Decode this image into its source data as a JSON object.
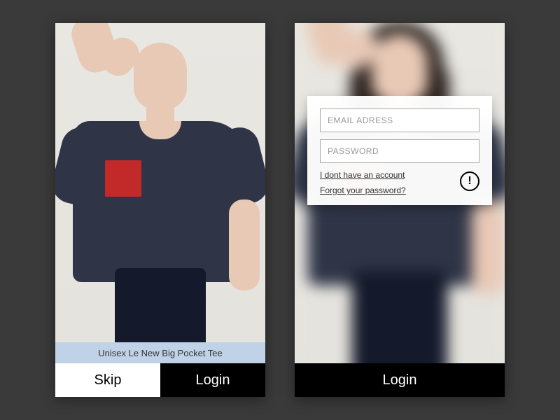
{
  "left": {
    "product_caption": "Unisex Le New Big Pocket Tee",
    "skip_label": "Skip",
    "login_label": "Login"
  },
  "right": {
    "email_placeholder": "EMAIL ADRESS",
    "password_placeholder": "PASSWORD",
    "no_account_link": "I dont have an account",
    "forgot_link": "Forgot your password?",
    "login_label": "Login"
  },
  "colors": {
    "shirt": "#2f3547",
    "pocket": "#c22a2a",
    "caption_bg": "#c0d2e7"
  }
}
